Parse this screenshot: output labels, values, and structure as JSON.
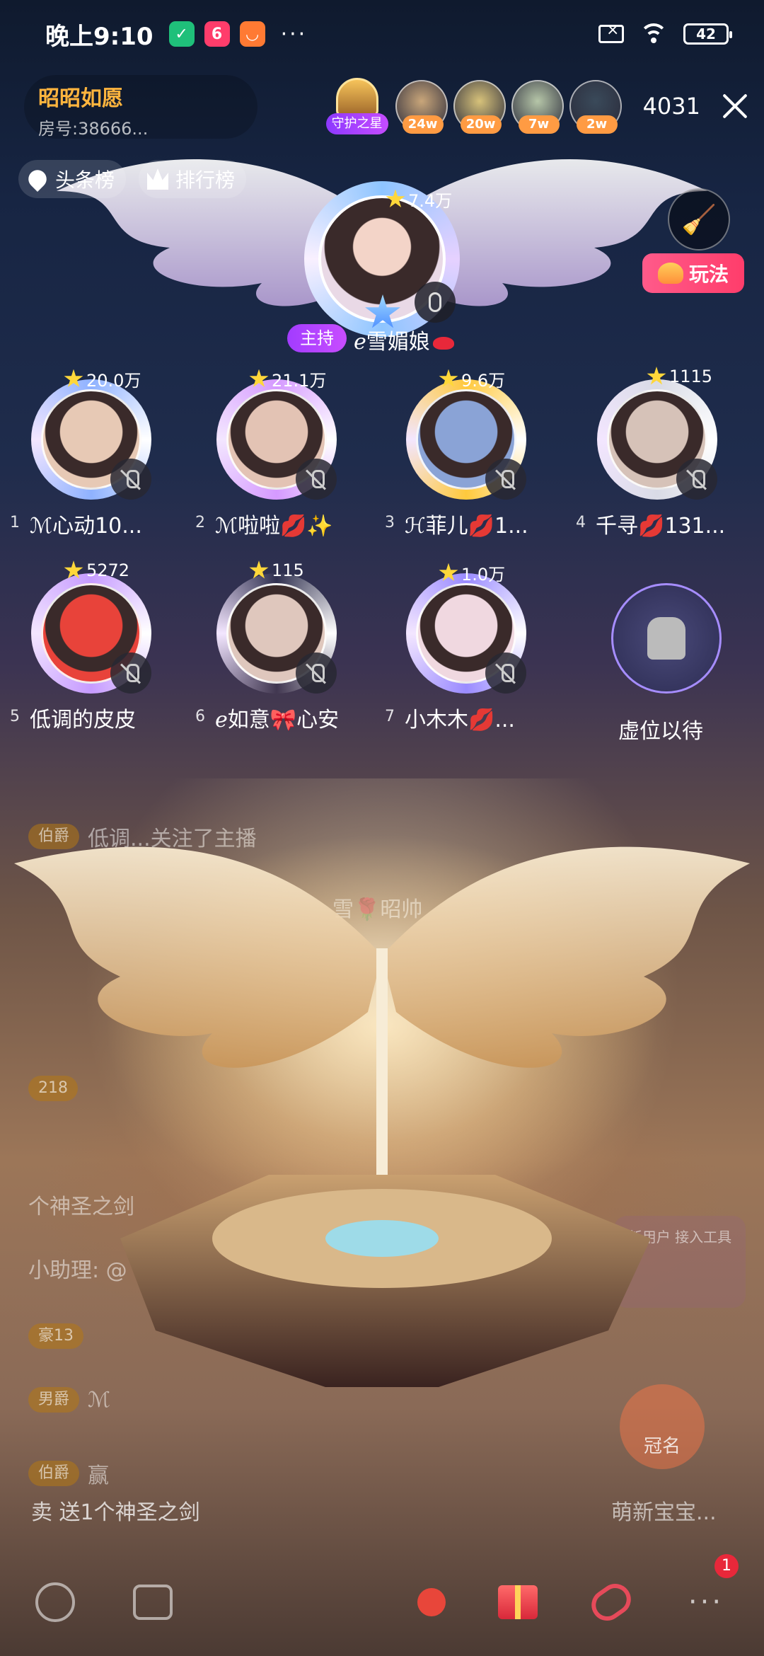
{
  "status_bar": {
    "time": "晚上9:10",
    "battery": "42",
    "more": "···"
  },
  "room": {
    "name": "昭昭如愿",
    "room_id": "房号:38666..."
  },
  "guard": {
    "label": "守护之星"
  },
  "viewers": [
    {
      "amount": "24w",
      "color": "#c9a67a"
    },
    {
      "amount": "20w",
      "color": "#d7c27a"
    },
    {
      "amount": "7w",
      "color": "#b6c6a8"
    },
    {
      "amount": "2w",
      "color": "#3a4a5a"
    }
  ],
  "viewer_count": "4031",
  "chips": {
    "headline": "头条榜",
    "ranking": "排行榜"
  },
  "play_button": "玩法",
  "host": {
    "score": "7.4万",
    "tag": "主持",
    "name": "ℯ雪媚娘"
  },
  "seats": [
    {
      "num": "1",
      "score": "20.0万",
      "nick": "ℳ心动10...",
      "frame": "#8fb2ff",
      "avatar": "#e7c9b5"
    },
    {
      "num": "2",
      "score": "21.1万",
      "nick": "ℳ啦啦💋✨",
      "frame": "#d59aff",
      "avatar": "#e3c3b4"
    },
    {
      "num": "3",
      "score": "9.6万",
      "nick": "ℋ菲儿💋1...",
      "frame": "#ffc93d",
      "avatar": "#8aa3d6"
    },
    {
      "num": "4",
      "score": "1115",
      "nick": "千寻💋131...",
      "frame": "#d9dbe6",
      "avatar": "#d6c2b8"
    },
    {
      "num": "5",
      "score": "5272",
      "nick": "低调的皮皮",
      "frame": "#c69bff",
      "avatar": "#e8433a"
    },
    {
      "num": "6",
      "score": "115",
      "nick": "ℯ如意🎀心安",
      "frame": "rgba(255,255,255,0)",
      "avatar": "#dfc7bd"
    },
    {
      "num": "7",
      "score": "1.0万",
      "nick": "小木木💋...",
      "frame": "#9a8bff",
      "avatar": "#f0d8e0"
    }
  ],
  "empty_seat": {
    "label": "虚位以待"
  },
  "chat": [
    {
      "level": "伯爵",
      "text": "低调...关注了主播"
    },
    {
      "level": "",
      "text": "雪🌹昭帅"
    },
    {
      "level": "218",
      "text": ""
    },
    {
      "level": "",
      "text": "个神圣之剑"
    },
    {
      "level": "",
      "text": "小助理: @"
    },
    {
      "level": "豪13",
      "text": ""
    },
    {
      "level": "男爵",
      "text": "ℳ"
    },
    {
      "level": "伯爵",
      "text": "赢"
    }
  ],
  "gift_message": "卖 送1个神圣之剑",
  "corner_user": "萌新宝宝...",
  "activity_card": "新用户\n接入工具",
  "crown_label": "冠名",
  "more_badge": "1",
  "bottom_more": "···"
}
